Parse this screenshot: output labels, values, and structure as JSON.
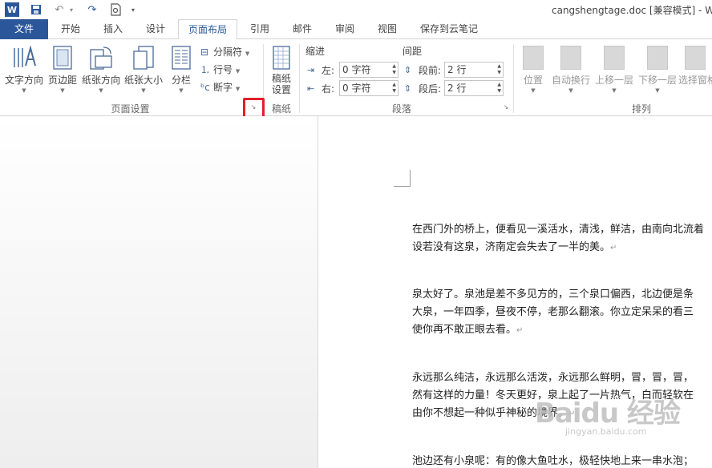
{
  "titlebar": {
    "app_icon": "W",
    "save_icon": "save-icon",
    "undo_icon": "undo-icon",
    "redo_icon": "redo-icon",
    "print_preview_icon": "print-preview-icon",
    "doc_title": "cangshengtage.doc [兼容模式] - W"
  },
  "tabs": [
    "文件",
    "开始",
    "插入",
    "设计",
    "页面布局",
    "引用",
    "邮件",
    "审阅",
    "视图",
    "保存到云笔记"
  ],
  "active_tab": "页面布局",
  "ribbon": {
    "page_setup": {
      "label": "页面设置",
      "text_direction": "文字方向",
      "margins": "页边距",
      "orientation": "纸张方向",
      "size": "纸张大小",
      "columns": "分栏",
      "breaks": "分隔符",
      "line_numbers": "行号",
      "hyphenation": "断字"
    },
    "manuscript": {
      "label": "稿纸",
      "button_line1": "稿纸",
      "button_line2": "设置"
    },
    "paragraph": {
      "label": "段落",
      "indent_head": "缩进",
      "spacing_head": "间距",
      "indent_left_label": "左:",
      "indent_left_value": "0 字符",
      "indent_right_label": "右:",
      "indent_right_value": "0 字符",
      "spacing_before_label": "段前:",
      "spacing_before_value": "2 行",
      "spacing_after_label": "段后:",
      "spacing_after_value": "2 行"
    },
    "arrange": {
      "label": "排列",
      "position": "位置",
      "wrap_text": "自动换行",
      "bring_forward": "上移一层",
      "send_backward": "下移一层",
      "selection_pane": "选择窗格"
    }
  },
  "document": {
    "paragraphs": [
      [
        "在西门外的桥上，便看见一溪活水，清浅，鲜洁，由南向北流着",
        "设若没有这泉，济南定会失去了一半的美。"
      ],
      [
        "泉太好了。泉池是差不多见方的，三个泉口偏西，北边便是条",
        "大泉，一年四季，昼夜不停，老那么翻滚。你立定呆呆的看三",
        "使你再不敢正眼去看。"
      ],
      [
        "永远那么纯洁，永远那么活泼，永远那么鲜明，冒，冒，冒，",
        "然有这样的力量！冬天更好，泉上起了一片热气，白而轻软在",
        "由你不想起一种似乎神秘的境界。"
      ],
      [
        "池边还有小泉呢：有的像大鱼吐水，极轻快地上来一串水泡；"
      ]
    ],
    "paragraph_mark": "↵"
  },
  "watermark": {
    "logo": "Baidu 经验",
    "sub": "jingyan.baidu.com"
  },
  "colors": {
    "accent": "#2b579a",
    "highlight": "#e0202a"
  }
}
